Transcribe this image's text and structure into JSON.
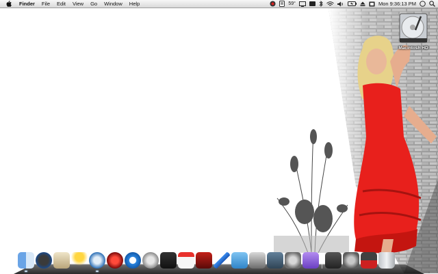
{
  "menubar": {
    "app_name": "Finder",
    "menus": [
      "File",
      "Edit",
      "View",
      "Go",
      "Window",
      "Help"
    ],
    "status": {
      "temperature": "59°",
      "clock": "Mon 9:36:13 PM"
    }
  },
  "desktop": {
    "drive_label": "Macintosh HD"
  },
  "dock": {
    "items": [
      {
        "icon": "finder-icon",
        "running": true
      },
      {
        "icon": "dashboard-icon",
        "running": false
      },
      {
        "icon": "preview-icon",
        "running": false
      },
      {
        "icon": "aim-icon",
        "running": false
      },
      {
        "icon": "safari-icon",
        "running": true
      },
      {
        "icon": "ical-widget-icon",
        "running": false
      },
      {
        "icon": "quicktime-icon",
        "running": false
      },
      {
        "icon": "itunes-icon",
        "running": false
      },
      {
        "icon": "vlc-icon",
        "running": false
      },
      {
        "icon": "ical-icon",
        "running": false
      },
      {
        "icon": "photo-booth-icon",
        "running": false
      },
      {
        "icon": "pen-icon",
        "running": false
      },
      {
        "icon": "textmate-icon",
        "running": false
      },
      {
        "icon": "iphoto-icon",
        "running": false
      },
      {
        "icon": "expose-icon",
        "running": false
      },
      {
        "icon": "system-preferences-icon",
        "running": false
      },
      {
        "icon": "folder-icon",
        "running": false
      },
      {
        "icon": "documents-stack-icon",
        "running": false
      },
      {
        "icon": "downloads-stack-icon",
        "running": false
      },
      {
        "icon": "applications-stack-icon",
        "running": false
      },
      {
        "icon": "trash-icon",
        "running": false
      }
    ]
  }
}
